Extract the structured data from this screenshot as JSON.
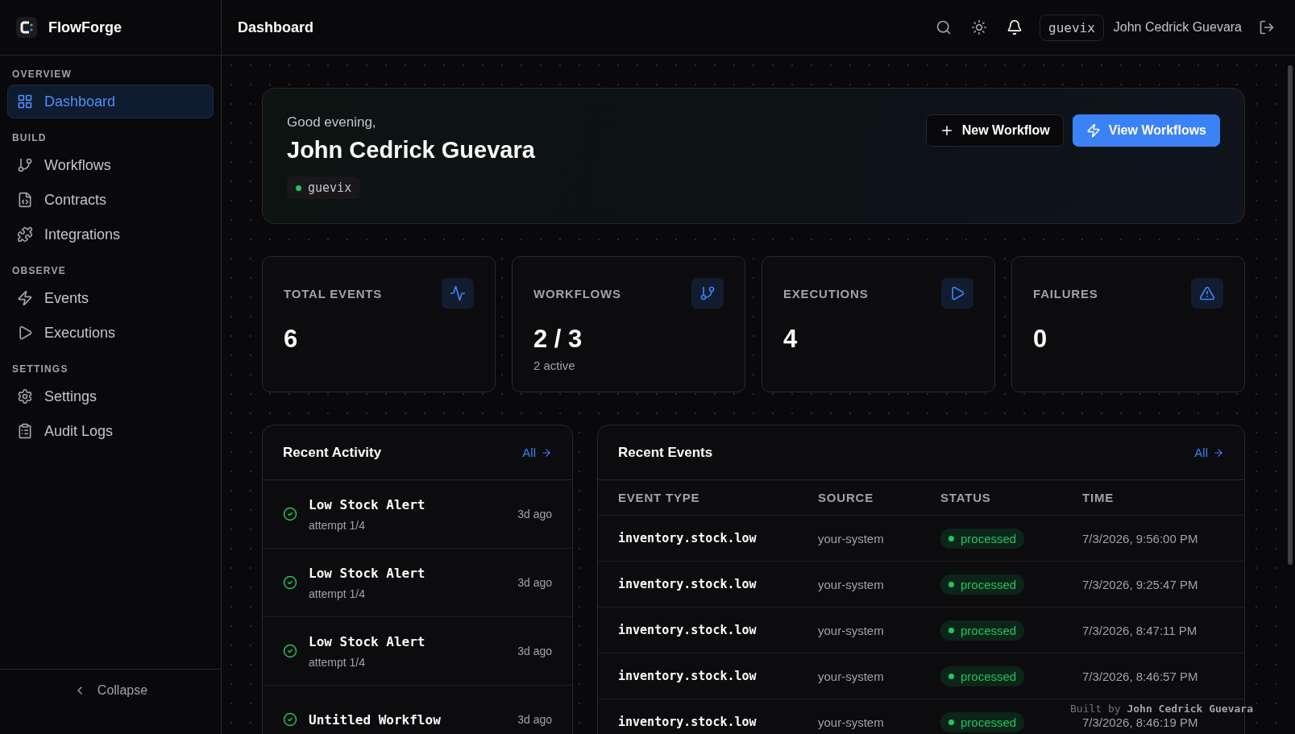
{
  "brand": {
    "name": "FlowForge"
  },
  "header": {
    "title": "Dashboard",
    "username": "guevix",
    "full_name": "John Cedrick Guevara"
  },
  "sidebar": {
    "sections": [
      {
        "title": "OVERVIEW",
        "items": [
          {
            "label": "Dashboard",
            "selected": true
          }
        ]
      },
      {
        "title": "BUILD",
        "items": [
          {
            "label": "Workflows",
            "selected": false
          },
          {
            "label": "Contracts",
            "selected": false
          },
          {
            "label": "Integrations",
            "selected": false
          }
        ]
      },
      {
        "title": "OBSERVE",
        "items": [
          {
            "label": "Events",
            "selected": false
          },
          {
            "label": "Executions",
            "selected": false
          }
        ]
      },
      {
        "title": "SETTINGS",
        "items": [
          {
            "label": "Settings",
            "selected": false
          },
          {
            "label": "Audit Logs",
            "selected": false
          }
        ]
      }
    ],
    "collapse": "Collapse"
  },
  "welcome": {
    "greeting": "Good evening,",
    "name": "John Cedrick Guevara",
    "handle": "guevix",
    "buttons": [
      {
        "label": "New Workflow",
        "kind": "secondary"
      },
      {
        "label": "View Workflows",
        "kind": "primary"
      }
    ]
  },
  "stats": [
    {
      "label": "TOTAL EVENTS",
      "value": "6"
    },
    {
      "label": "WORKFLOWS",
      "value": "2 / 3",
      "sub": "2 active"
    },
    {
      "label": "EXECUTIONS",
      "value": "4"
    },
    {
      "label": "FAILURES",
      "value": "0"
    }
  ],
  "recent_activity": {
    "title": "Recent Activity",
    "link": "All",
    "items": [
      {
        "name": "Low Stock Alert",
        "meta": "attempt 1/4",
        "time": "3d ago",
        "kind": "success"
      },
      {
        "name": "Low Stock Alert",
        "meta": "attempt 1/4",
        "time": "3d ago",
        "kind": "success"
      },
      {
        "name": "Low Stock Alert",
        "meta": "attempt 1/4",
        "time": "3d ago",
        "kind": "success"
      },
      {
        "name": "Untitled Workflow",
        "time": "3d ago",
        "kind": "success"
      }
    ]
  },
  "recent_events": {
    "title": "Recent Events",
    "link": "All",
    "columns": [
      "EVENT TYPE",
      "SOURCE",
      "STATUS",
      "TIME"
    ],
    "rows": [
      {
        "type": "inventory.stock.low",
        "source": "your-system",
        "status": "processed",
        "time": "7/3/2026, 9:56:00 PM"
      },
      {
        "type": "inventory.stock.low",
        "source": "your-system",
        "status": "processed",
        "time": "7/3/2026, 9:25:47 PM"
      },
      {
        "type": "inventory.stock.low",
        "source": "your-system",
        "status": "processed",
        "time": "7/3/2026, 8:47:11 PM"
      },
      {
        "type": "inventory.stock.low",
        "source": "your-system",
        "status": "processed",
        "time": "7/3/2026, 8:46:57 PM"
      },
      {
        "type": "inventory.stock.low",
        "source": "your-system",
        "status": "processed",
        "time": "7/3/2026, 8:46:19 PM"
      }
    ]
  },
  "footer": {
    "credit": "Built by **John Cedrick Guevara**"
  }
}
